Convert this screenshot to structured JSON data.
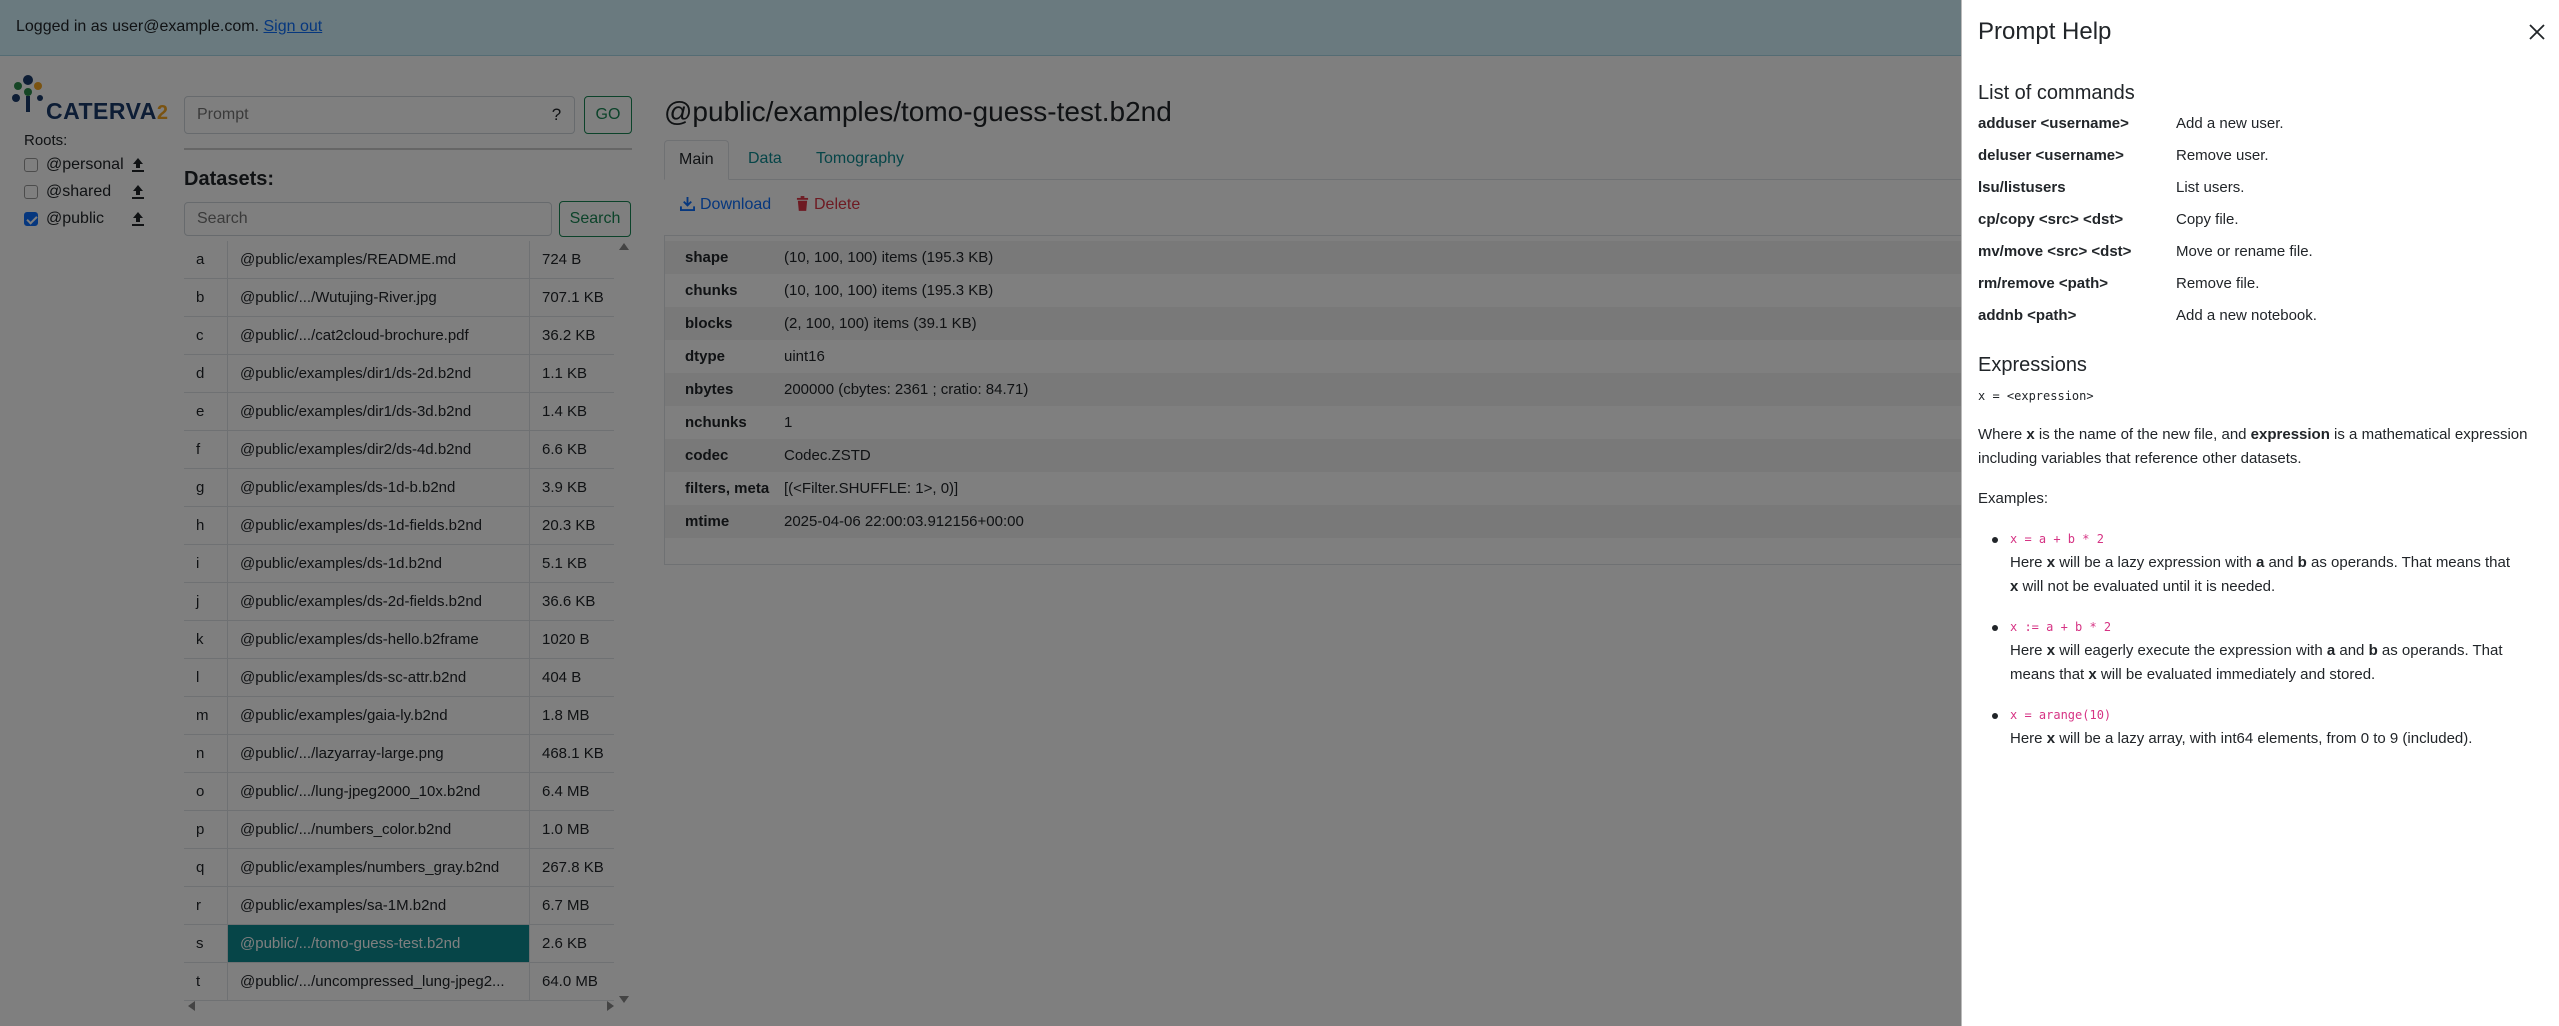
{
  "topbar": {
    "logged_in_prefix": "Logged in as user@example.com.",
    "sign_out": "Sign out"
  },
  "logo": {
    "word": "CATERVA",
    "suffix": "2"
  },
  "roots": {
    "title": "Roots:",
    "items": [
      {
        "name": "@personal",
        "checked": false
      },
      {
        "name": "@shared",
        "checked": false
      },
      {
        "name": "@public",
        "checked": true
      }
    ]
  },
  "prompt": {
    "placeholder": "Prompt",
    "help_label": "?",
    "go_label": "GO"
  },
  "datasets": {
    "title": "Datasets:",
    "search_placeholder": "Search",
    "search_label": "Search",
    "rows": [
      {
        "key": "a",
        "path": "@public/examples/README.md",
        "size": "724 B"
      },
      {
        "key": "b",
        "path": "@public/.../Wutujing-River.jpg",
        "size": "707.1 KB"
      },
      {
        "key": "c",
        "path": "@public/.../cat2cloud-brochure.pdf",
        "size": "36.2 KB"
      },
      {
        "key": "d",
        "path": "@public/examples/dir1/ds-2d.b2nd",
        "size": "1.1 KB"
      },
      {
        "key": "e",
        "path": "@public/examples/dir1/ds-3d.b2nd",
        "size": "1.4 KB"
      },
      {
        "key": "f",
        "path": "@public/examples/dir2/ds-4d.b2nd",
        "size": "6.6 KB"
      },
      {
        "key": "g",
        "path": "@public/examples/ds-1d-b.b2nd",
        "size": "3.9 KB"
      },
      {
        "key": "h",
        "path": "@public/examples/ds-1d-fields.b2nd",
        "size": "20.3 KB"
      },
      {
        "key": "i",
        "path": "@public/examples/ds-1d.b2nd",
        "size": "5.1 KB"
      },
      {
        "key": "j",
        "path": "@public/examples/ds-2d-fields.b2nd",
        "size": "36.6 KB"
      },
      {
        "key": "k",
        "path": "@public/examples/ds-hello.b2frame",
        "size": "1020 B"
      },
      {
        "key": "l",
        "path": "@public/examples/ds-sc-attr.b2nd",
        "size": "404 B"
      },
      {
        "key": "m",
        "path": "@public/examples/gaia-ly.b2nd",
        "size": "1.8 MB"
      },
      {
        "key": "n",
        "path": "@public/.../lazyarray-large.png",
        "size": "468.1 KB"
      },
      {
        "key": "o",
        "path": "@public/.../lung-jpeg2000_10x.b2nd",
        "size": "6.4 MB"
      },
      {
        "key": "p",
        "path": "@public/.../numbers_color.b2nd",
        "size": "1.0 MB"
      },
      {
        "key": "q",
        "path": "@public/examples/numbers_gray.b2nd",
        "size": "267.8 KB"
      },
      {
        "key": "r",
        "path": "@public/examples/sa-1M.b2nd",
        "size": "6.7 MB"
      },
      {
        "key": "s",
        "path": "@public/.../tomo-guess-test.b2nd",
        "size": "2.6 KB",
        "selected": true
      },
      {
        "key": "t",
        "path": "@public/.../uncompressed_lung-jpeg2...",
        "size": "64.0 MB"
      }
    ]
  },
  "main": {
    "title": "@public/examples/tomo-guess-test.b2nd",
    "tabs": [
      {
        "label": "Main",
        "active": true
      },
      {
        "label": "Data",
        "active": false
      },
      {
        "label": "Tomography",
        "active": false
      }
    ],
    "download_label": "Download",
    "delete_label": "Delete",
    "meta": [
      {
        "key": "shape",
        "value": "(10, 100, 100) items (195.3 KB)"
      },
      {
        "key": "chunks",
        "value": "(10, 100, 100) items (195.3 KB)"
      },
      {
        "key": "blocks",
        "value": "(2, 100, 100) items (39.1 KB)"
      },
      {
        "key": "dtype",
        "value": "uint16"
      },
      {
        "key": "nbytes",
        "value": "200000 (cbytes: 2361 ; cratio: 84.71)"
      },
      {
        "key": "nchunks",
        "value": "1"
      },
      {
        "key": "codec",
        "value": "Codec.ZSTD"
      },
      {
        "key": "filters, meta",
        "value": "[(<Filter.SHUFFLE: 1>, 0)]"
      },
      {
        "key": "mtime",
        "value": "2025-04-06 22:00:03.912156+00:00"
      }
    ]
  },
  "help": {
    "title": "Prompt Help",
    "commands_title": "List of commands",
    "commands": [
      {
        "cmd": "adduser <username>",
        "desc": "Add a new user."
      },
      {
        "cmd": "deluser <username>",
        "desc": "Remove user."
      },
      {
        "cmd": "lsu/listusers",
        "desc": "List users."
      },
      {
        "cmd": "cp/copy <src> <dst>",
        "desc": "Copy file."
      },
      {
        "cmd": "mv/move <src> <dst>",
        "desc": "Move or rename file."
      },
      {
        "cmd": "rm/remove <path>",
        "desc": "Remove file."
      },
      {
        "cmd": "addnb <path>",
        "desc": "Add a new notebook."
      }
    ],
    "expressions_title": "Expressions",
    "expr_syntax": "x = <expression>",
    "where_1": "Where ",
    "where_x": "x",
    "where_2": " is the name of the new file, and ",
    "where_expr": "expression",
    "where_3": " is a mathematical expression including variables that reference other datasets.",
    "examples_title": "Examples:",
    "ex1_code": "x = a + b * 2",
    "ex1_t1": "Here ",
    "ex1_x": "x",
    "ex1_t2": " will be a lazy expression with ",
    "ex1_a": "a",
    "ex1_t3": " and ",
    "ex1_b": "b",
    "ex1_t4": " as operands. That means that",
    "ex1_x2": "x",
    "ex1_t5": " will not be evaluated until it is needed.",
    "ex2_code": "x := a + b * 2",
    "ex2_t1": "Here ",
    "ex2_x": "x",
    "ex2_t2": " will eagerly execute the expression with ",
    "ex2_a": "a",
    "ex2_t3": " and ",
    "ex2_b": "b",
    "ex2_t4": " as operands. That",
    "ex2_t5": "means that ",
    "ex2_x2": "x",
    "ex2_t6": " will be evaluated immediately and stored.",
    "ex3_code": "x = arange(10)",
    "ex3_t1": "Here ",
    "ex3_x": "x",
    "ex3_t2": " will be a lazy array, with int64 elements, from 0 to 9 (included)."
  }
}
